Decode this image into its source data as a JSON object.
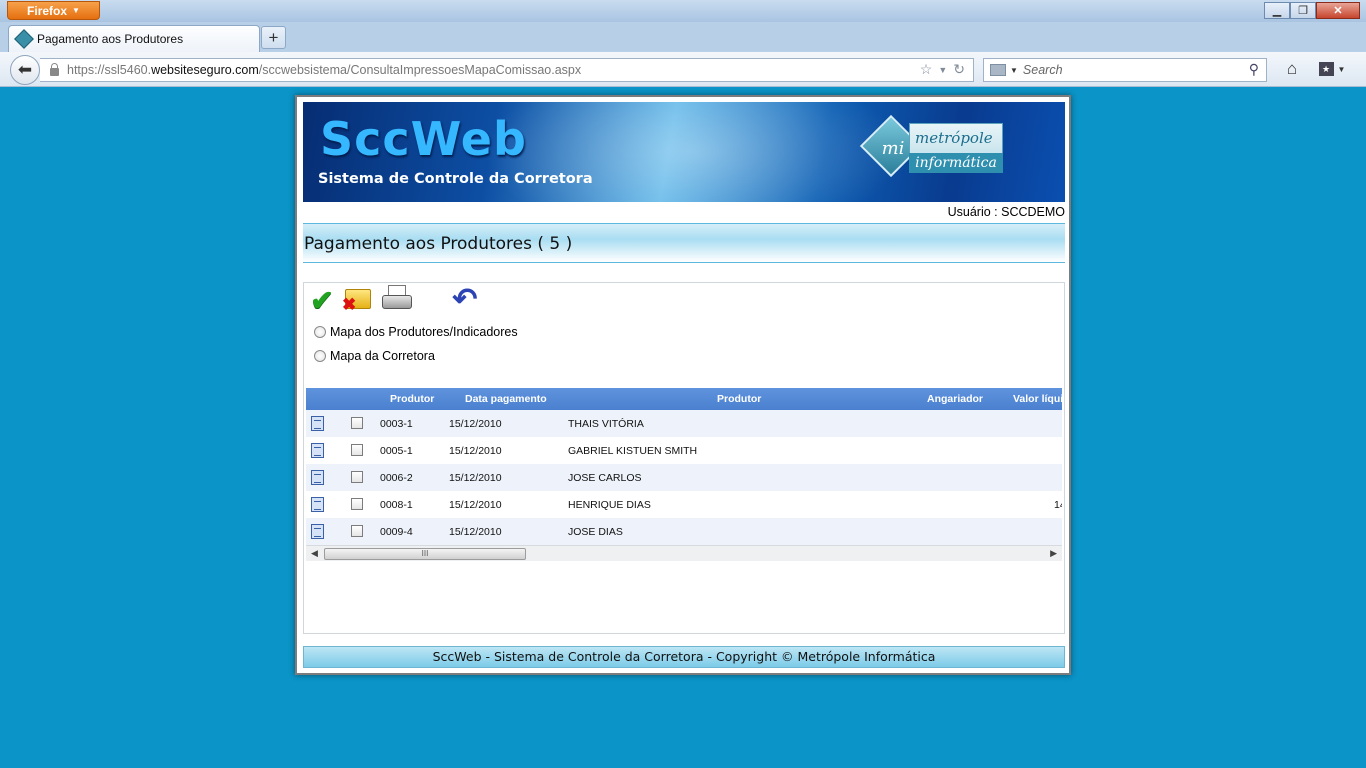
{
  "browser": {
    "menu_button": "Firefox",
    "tab_title": "Pagamento aos Produtores",
    "url_prefix": "https://ssl5460.",
    "url_host": "websiteseguro.com",
    "url_path": "/sccwebsistema/ConsultaImpressoesMapaComissao.aspx",
    "search_placeholder": "Search"
  },
  "banner": {
    "title": "SccWeb",
    "subtitle": "Sistema de Controle da Corretora",
    "logo_mark": "mi",
    "logo_word1": "metrópole",
    "logo_word2": "informática"
  },
  "user_line": "Usuário : SCCDEMO",
  "page_title": "Pagamento aos Produtores ( 5 )",
  "options": [
    {
      "label": "Mapa dos Produtores/Indicadores"
    },
    {
      "label": "Mapa da Corretora"
    }
  ],
  "grid": {
    "headers": {
      "produtor_code": "Produtor",
      "data_pagamento": "Data pagamento",
      "produtor_name": "Produtor",
      "angariador": "Angariador",
      "valor": "Valor líqui"
    },
    "rows": [
      {
        "code": "0003-1",
        "date": "15/12/2010",
        "name": "THAIS VITÓRIA",
        "valor": ""
      },
      {
        "code": "0005-1",
        "date": "15/12/2010",
        "name": "GABRIEL KISTUEN SMITH",
        "valor": ""
      },
      {
        "code": "0006-2",
        "date": "15/12/2010",
        "name": "JOSE CARLOS",
        "valor": ""
      },
      {
        "code": "0008-1",
        "date": "15/12/2010",
        "name": "HENRIQUE DIAS",
        "valor": "14"
      },
      {
        "code": "0009-4",
        "date": "15/12/2010",
        "name": "JOSE DIAS",
        "valor": ""
      }
    ],
    "scroll_thumb_label": "III"
  },
  "footer": "SccWeb - Sistema de Controle da Corretora - Copyright © Metrópole Informática"
}
